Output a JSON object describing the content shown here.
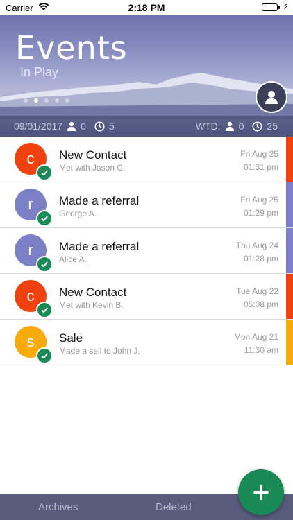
{
  "status_bar": {
    "carrier": "Carrier",
    "time": "2:18 PM",
    "icons": [
      "wifi-icon",
      "battery-icon",
      "charging-bolt-icon"
    ]
  },
  "header": {
    "title": "Events",
    "subtitle": "In Play",
    "page_count": 5,
    "active_page": 2
  },
  "stats": {
    "date": "09/01/2017",
    "day_contacts": "0",
    "day_time": "5",
    "wtd_label": "WTD:",
    "wtd_contacts": "0",
    "wtd_time": "25"
  },
  "events": [
    {
      "initial": "c",
      "title": "New Contact",
      "subtitle": "Met with Jason C.",
      "date": "Fri Aug 25",
      "time": "01:31 pm",
      "color": "#f0420f"
    },
    {
      "initial": "r",
      "title": "Made a referral",
      "subtitle": "George A.",
      "date": "Fri Aug 25",
      "time": "01:29 pm",
      "color": "#7c80c4"
    },
    {
      "initial": "r",
      "title": "Made a referral",
      "subtitle": "Alice A.",
      "date": "Thu Aug 24",
      "time": "01:28 pm",
      "color": "#7c80c4"
    },
    {
      "initial": "c",
      "title": "New Contact",
      "subtitle": "Met with Kevin B.",
      "date": "Tue Aug 22",
      "time": "05:08 pm",
      "color": "#f0420f"
    },
    {
      "initial": "s",
      "title": "Sale",
      "subtitle": "Made a sell to John J.",
      "date": "Mon Aug 21",
      "time": "11:30 am",
      "color": "#f7ab0a"
    }
  ],
  "bottom_bar": {
    "archives_label": "Archives",
    "deleted_label": "Deleted"
  },
  "colors": {
    "check_green": "#1a8a56",
    "bottom_bar": "#585b7b"
  }
}
